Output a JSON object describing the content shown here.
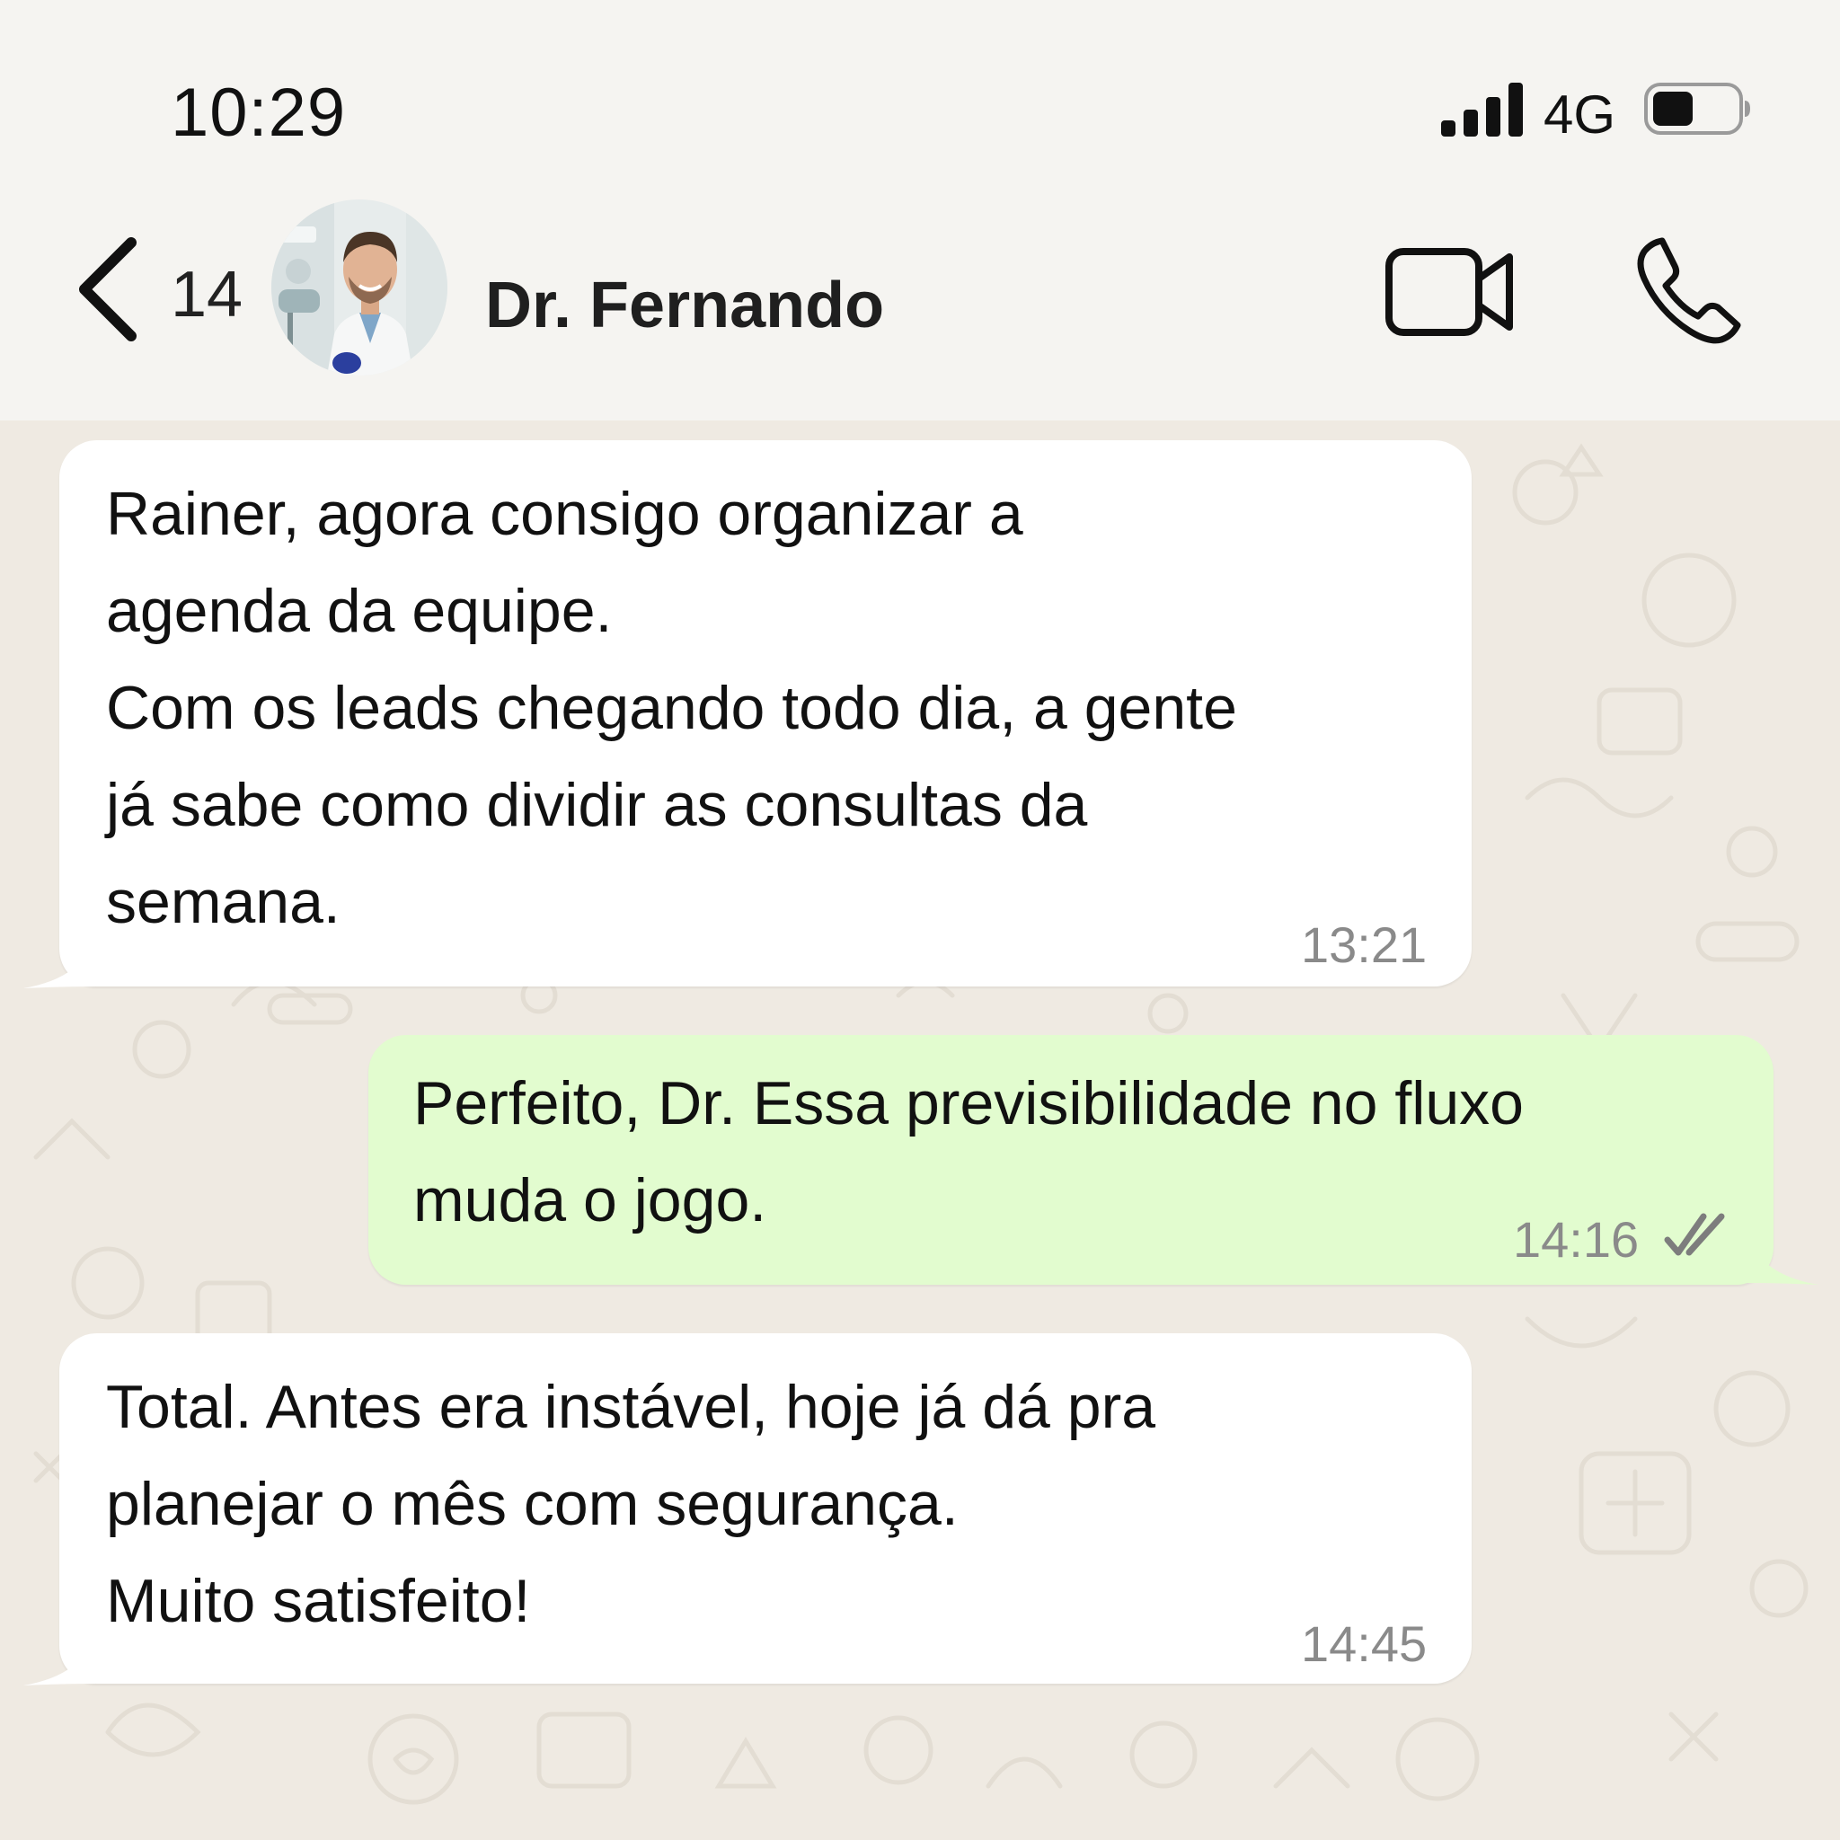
{
  "status_bar": {
    "time": "10:29",
    "network": "4G",
    "signal_icon": "signal-bars-icon",
    "battery_icon": "battery-icon"
  },
  "header": {
    "back_icon": "chevron-left-icon",
    "unread_count": "14",
    "contact_name": "Dr. Fernando",
    "video_icon": "video-camera-icon",
    "phone_icon": "phone-icon"
  },
  "messages": [
    {
      "direction": "incoming",
      "text": "Rainer, agora consigo organizar a\nagenda da equipe.\nCom os leads chegando todo dia, a gente\njá sabe como dividir as consultas da\nsemana.",
      "time": "13:21"
    },
    {
      "direction": "outgoing",
      "text": "Perfeito, Dr. Essa previsibilidade no fluxo\nmuda o jogo.",
      "time": "14:16",
      "status_icon": "double-check-icon"
    },
    {
      "direction": "incoming",
      "text": "Total. Antes era instável, hoje já dá pra\nplanejar o mês com segurança.\nMuito satisfeito!",
      "time": "14:45"
    }
  ],
  "colors": {
    "incoming_bubble": "#ffffff",
    "outgoing_bubble": "#e2fccf",
    "chat_background": "#efeae2",
    "header_background": "#f5f4f1"
  }
}
